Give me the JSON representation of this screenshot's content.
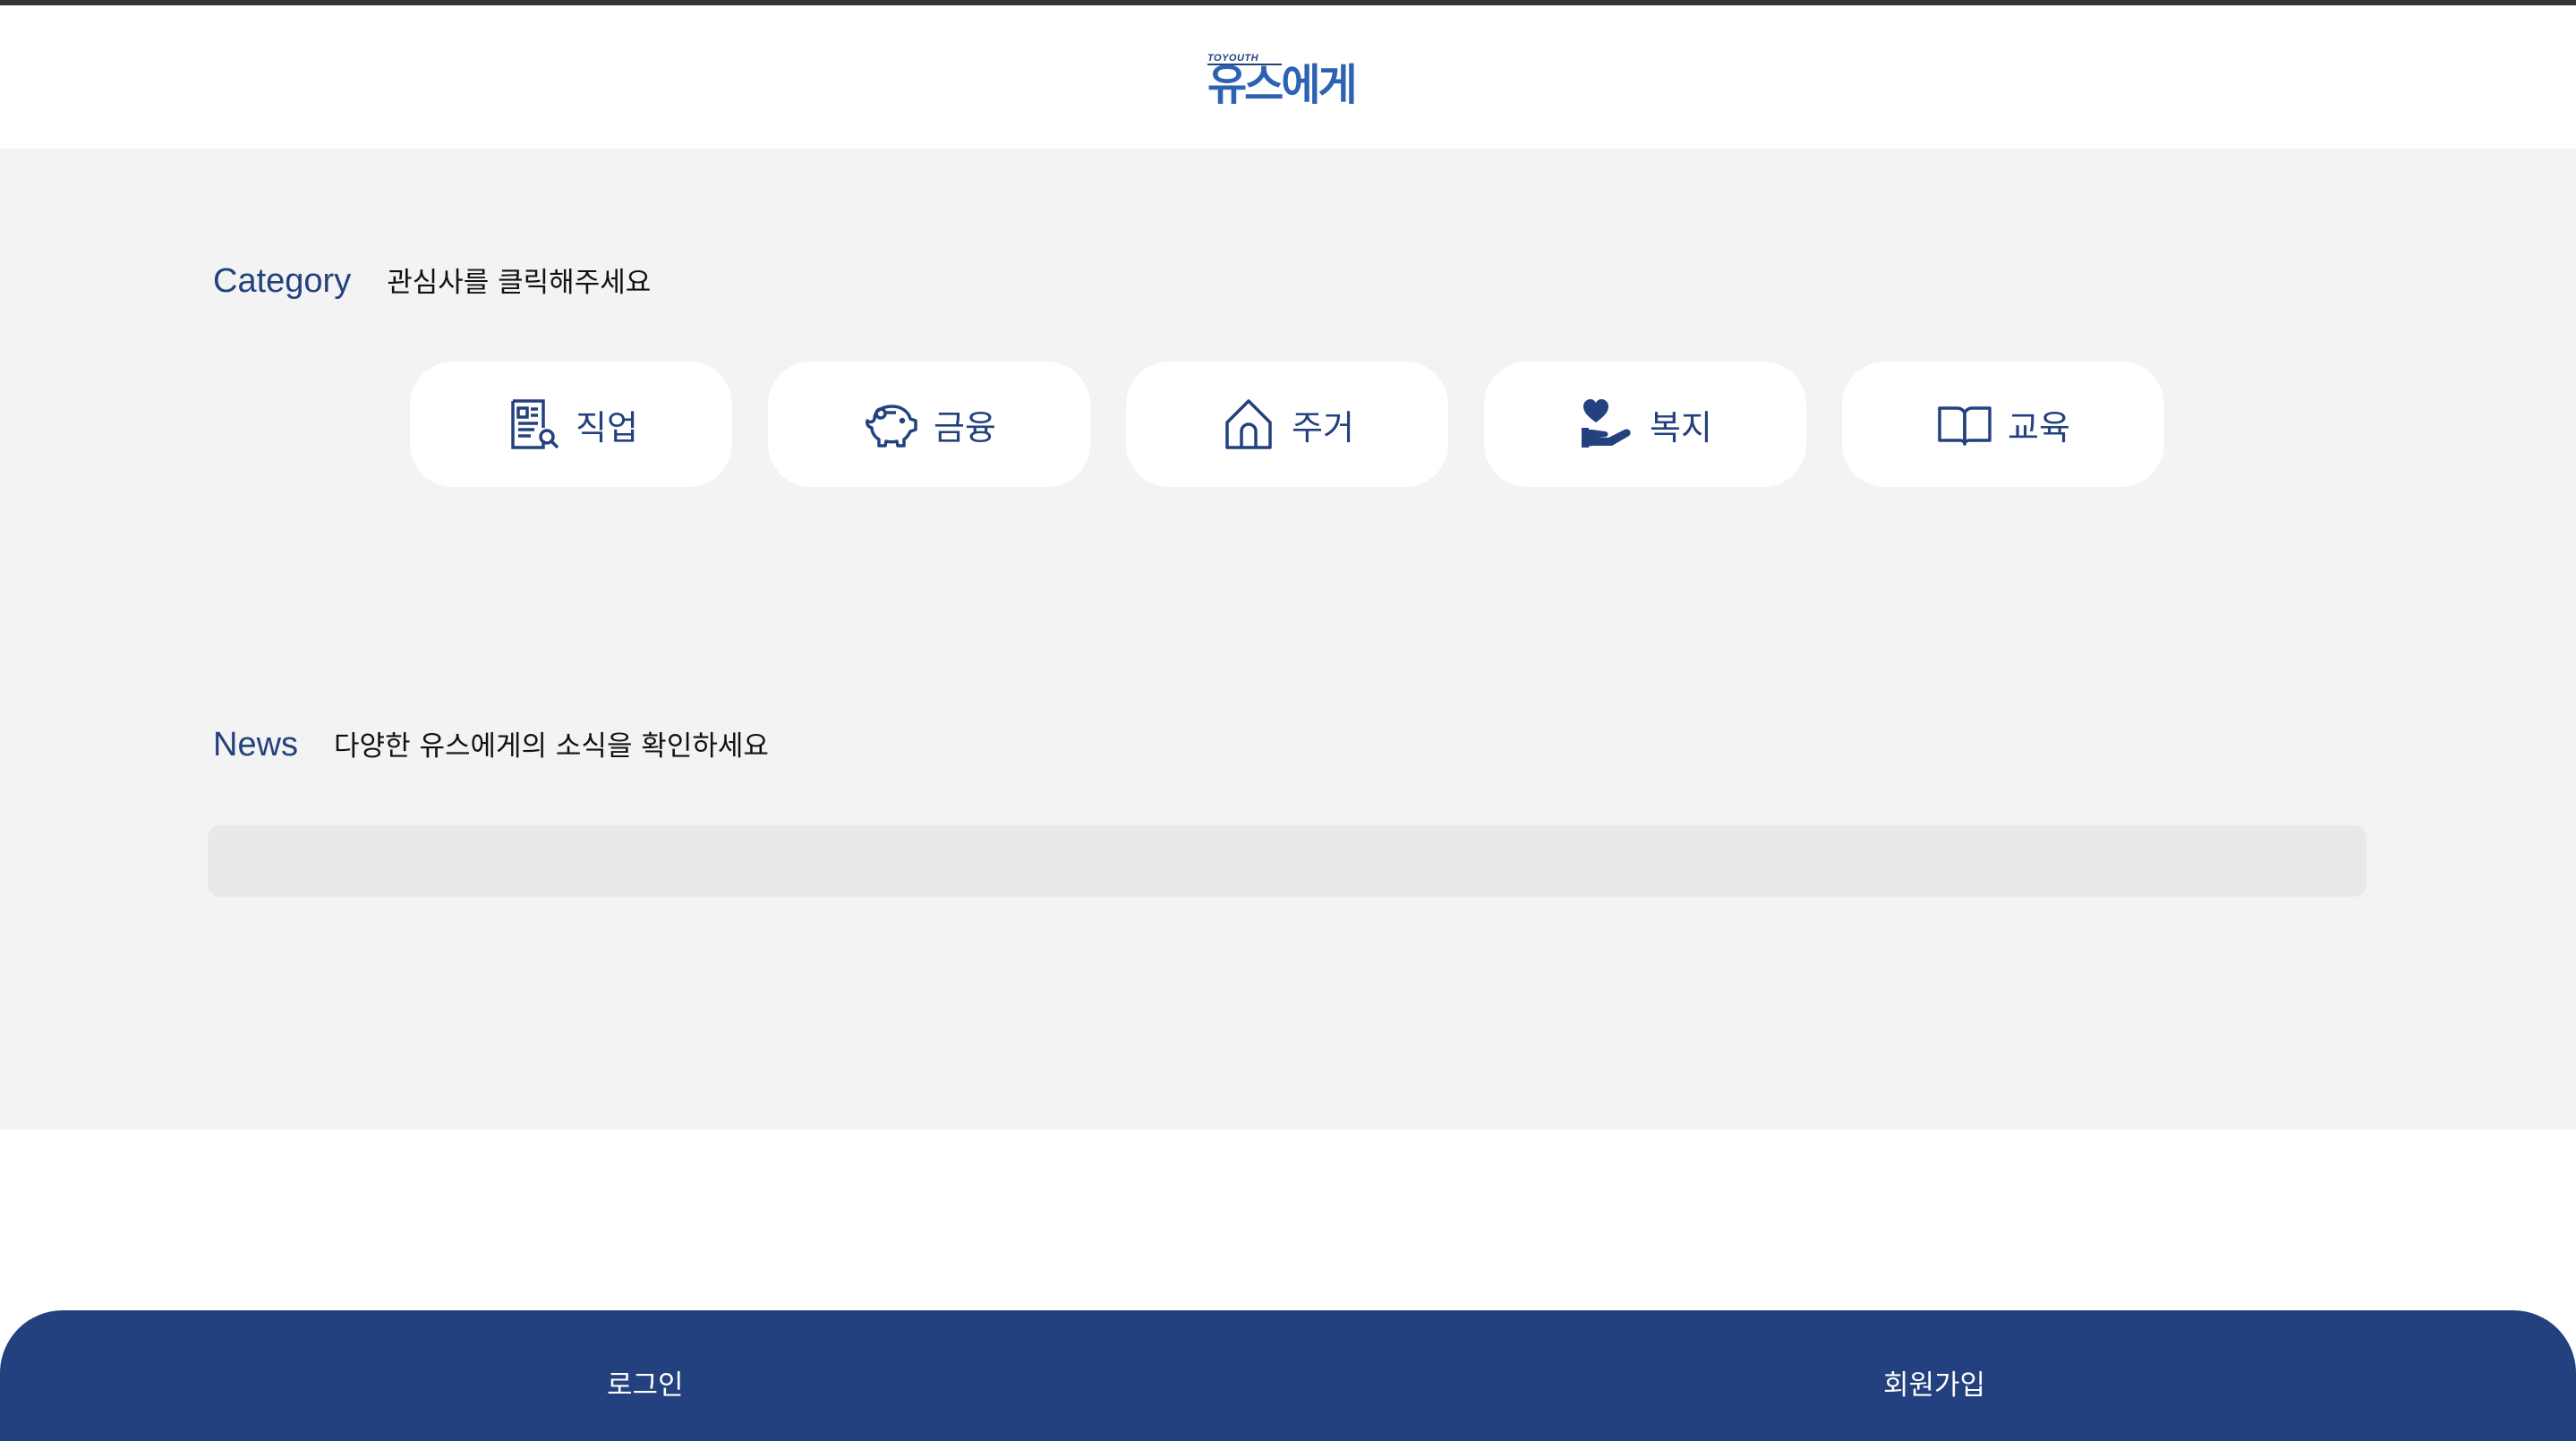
{
  "header": {
    "logo_small": "TOYOUTH",
    "logo_main": "유스에게"
  },
  "category": {
    "title": "Category",
    "subtitle": "관심사를 클릭해주세요",
    "items": [
      {
        "label": "직업",
        "icon": "job-document-icon"
      },
      {
        "label": "금융",
        "icon": "piggy-bank-icon"
      },
      {
        "label": "주거",
        "icon": "house-icon"
      },
      {
        "label": "복지",
        "icon": "heart-hand-icon"
      },
      {
        "label": "교육",
        "icon": "open-book-icon"
      }
    ]
  },
  "news": {
    "title": "News",
    "subtitle": "다양한 유스에게의 소식을 확인하세요"
  },
  "footer": {
    "login_label": "로그인",
    "signup_label": "회원가입"
  },
  "colors": {
    "brand": "#23417e",
    "logo": "#2d62b3",
    "background": "#f3f3f3",
    "news_box": "#e9e9e9"
  }
}
